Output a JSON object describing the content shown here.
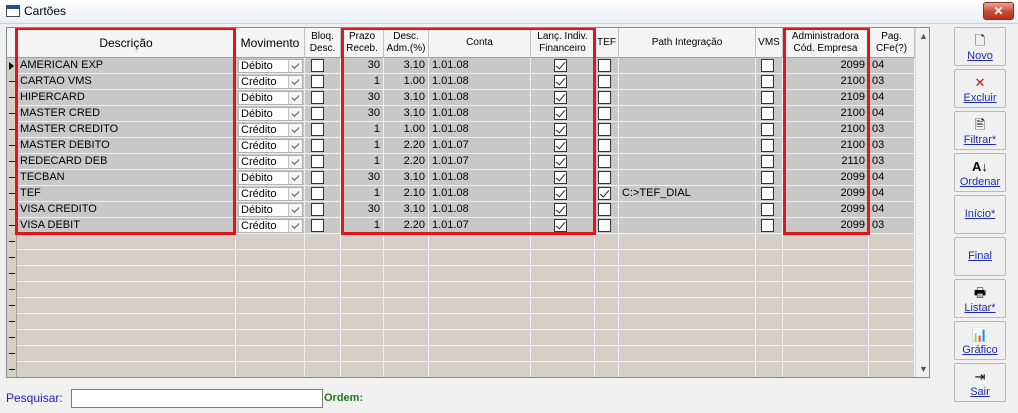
{
  "window": {
    "title": "Cartões",
    "close_label": "✕"
  },
  "columns": [
    {
      "key": "descricao",
      "label": "Descrição"
    },
    {
      "key": "movimento",
      "label": "Movimento"
    },
    {
      "key": "bloq",
      "label": "Bloq.\nDesc."
    },
    {
      "key": "prazo",
      "label": "Prazo\nReceb."
    },
    {
      "key": "desc",
      "label": "Desc.\nAdm.(%)"
    },
    {
      "key": "conta",
      "label": "Conta"
    },
    {
      "key": "lanc",
      "label": "Lanç. Indiv.\nFinanceiro"
    },
    {
      "key": "tef",
      "label": "TEF"
    },
    {
      "key": "path",
      "label": "Path Integração"
    },
    {
      "key": "vms",
      "label": "VMS"
    },
    {
      "key": "admin",
      "label": "Administradora\nCód. Empresa"
    },
    {
      "key": "pag",
      "label": "Pag.\nCFe(?)"
    }
  ],
  "rows": [
    {
      "descricao": "AMERICAN EXP",
      "movimento": "Débito",
      "bloq": false,
      "prazo": "30",
      "desc": "3.10",
      "conta": "1.01.08",
      "lanc": true,
      "tef": false,
      "path": "",
      "vms": false,
      "admin": "2099",
      "pag": "04"
    },
    {
      "descricao": "CARTAO VMS",
      "movimento": "Crédito",
      "bloq": false,
      "prazo": "1",
      "desc": "1.00",
      "conta": "1.01.08",
      "lanc": true,
      "tef": false,
      "path": "",
      "vms": false,
      "admin": "2100",
      "pag": "03"
    },
    {
      "descricao": "HIPERCARD",
      "movimento": "Débito",
      "bloq": false,
      "prazo": "30",
      "desc": "3.10",
      "conta": "1.01.08",
      "lanc": true,
      "tef": false,
      "path": "",
      "vms": false,
      "admin": "2109",
      "pag": "04"
    },
    {
      "descricao": "MASTER CRED",
      "movimento": "Débito",
      "bloq": false,
      "prazo": "30",
      "desc": "3.10",
      "conta": "1.01.08",
      "lanc": true,
      "tef": false,
      "path": "",
      "vms": false,
      "admin": "2100",
      "pag": "04"
    },
    {
      "descricao": "MASTER CREDITO",
      "movimento": "Crédito",
      "bloq": false,
      "prazo": "1",
      "desc": "1.00",
      "conta": "1.01.08",
      "lanc": true,
      "tef": false,
      "path": "",
      "vms": false,
      "admin": "2100",
      "pag": "03"
    },
    {
      "descricao": "MASTER DEBITO",
      "movimento": "Crédito",
      "bloq": false,
      "prazo": "1",
      "desc": "2.20",
      "conta": "1.01.07",
      "lanc": true,
      "tef": false,
      "path": "",
      "vms": false,
      "admin": "2100",
      "pag": "03"
    },
    {
      "descricao": "REDECARD DEB",
      "movimento": "Crédito",
      "bloq": false,
      "prazo": "1",
      "desc": "2.20",
      "conta": "1.01.07",
      "lanc": true,
      "tef": false,
      "path": "",
      "vms": false,
      "admin": "2110",
      "pag": "03"
    },
    {
      "descricao": "TECBAN",
      "movimento": "Débito",
      "bloq": false,
      "prazo": "30",
      "desc": "3.10",
      "conta": "1.01.08",
      "lanc": true,
      "tef": false,
      "path": "",
      "vms": false,
      "admin": "2099",
      "pag": "04"
    },
    {
      "descricao": "TEF",
      "movimento": "Crédito",
      "bloq": false,
      "prazo": "1",
      "desc": "2.10",
      "conta": "1.01.08",
      "lanc": true,
      "tef": true,
      "path": "C:>TEF_DIAL",
      "vms": false,
      "admin": "2099",
      "pag": "04"
    },
    {
      "descricao": "VISA CREDITO",
      "movimento": "Débito",
      "bloq": false,
      "prazo": "30",
      "desc": "3.10",
      "conta": "1.01.08",
      "lanc": true,
      "tef": false,
      "path": "",
      "vms": false,
      "admin": "2099",
      "pag": "04"
    },
    {
      "descricao": "VISA DEBIT",
      "movimento": "Crédito",
      "bloq": false,
      "prazo": "1",
      "desc": "2.20",
      "conta": "1.01.07",
      "lanc": true,
      "tef": false,
      "path": "",
      "vms": false,
      "admin": "2099",
      "pag": "03"
    }
  ],
  "search": {
    "label": "Pesquisar:",
    "value": "",
    "ordem_label": "Ordem:"
  },
  "sidebar": [
    {
      "icon": "new-document-icon",
      "glyph": "🗋",
      "label": "Novo"
    },
    {
      "icon": "delete-x-icon",
      "glyph": "✕",
      "label": "Excluir"
    },
    {
      "icon": "filter-icon",
      "glyph": "🖹",
      "label": "Filtrar*"
    },
    {
      "icon": "sort-az-icon",
      "glyph": "A↓",
      "label": "Ordenar"
    },
    {
      "icon": "",
      "glyph": "",
      "label": "Início*"
    },
    {
      "icon": "",
      "glyph": "",
      "label": "Final"
    },
    {
      "icon": "printer-icon",
      "glyph": "🖶",
      "label": "Listar*"
    },
    {
      "icon": "bar-chart-icon",
      "glyph": "📊",
      "label": "Gráfico"
    },
    {
      "icon": "exit-door-icon",
      "glyph": "⇥",
      "label": "Sair"
    }
  ],
  "colors": {
    "highlight_box": "#e2151b",
    "search_label": "#1e22b8",
    "ordem_label": "#1d7a1d"
  }
}
